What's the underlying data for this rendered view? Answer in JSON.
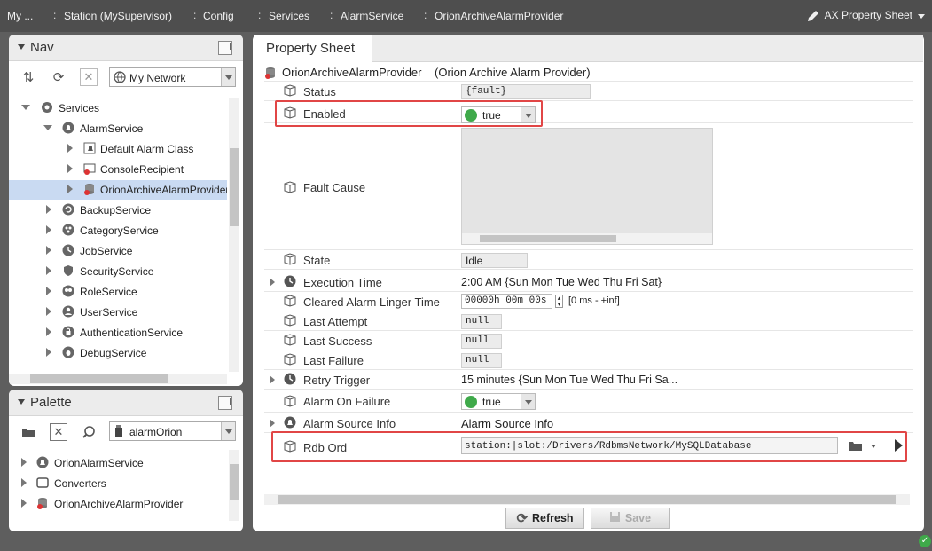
{
  "breadcrumb": [
    "My ...",
    "Station (MySupervisor)",
    "Config",
    "Services",
    "AlarmService",
    "OrionArchiveAlarmProvider"
  ],
  "view_selector": "AX Property Sheet",
  "nav": {
    "title": "Nav",
    "network_combo": "My Network",
    "tree": [
      {
        "label": "Services",
        "icon": "services-icon",
        "expanded": true
      },
      {
        "label": "AlarmService",
        "icon": "alarm-service-icon",
        "expanded": true
      },
      {
        "label": "Default Alarm Class",
        "icon": "alarm-class-icon"
      },
      {
        "label": "ConsoleRecipient",
        "icon": "console-recipient-icon"
      },
      {
        "label": "OrionArchiveAlarmProvider",
        "icon": "database-icon",
        "selected": true
      },
      {
        "label": "BackupService",
        "icon": "backup-icon"
      },
      {
        "label": "CategoryService",
        "icon": "category-icon"
      },
      {
        "label": "JobService",
        "icon": "job-icon"
      },
      {
        "label": "SecurityService",
        "icon": "shield-icon"
      },
      {
        "label": "RoleService",
        "icon": "role-icon"
      },
      {
        "label": "UserService",
        "icon": "user-icon"
      },
      {
        "label": "AuthenticationService",
        "icon": "lock-icon"
      },
      {
        "label": "DebugService",
        "icon": "debug-icon"
      }
    ]
  },
  "palette": {
    "title": "Palette",
    "module_combo": "alarmOrion",
    "items": [
      {
        "label": "OrionAlarmService",
        "icon": "alarm-service-icon"
      },
      {
        "label": "Converters",
        "icon": "folder-icon"
      },
      {
        "label": "OrionArchiveAlarmProvider",
        "icon": "database-icon"
      }
    ]
  },
  "property_sheet": {
    "tab": "Property Sheet",
    "object_name": "OrionArchiveAlarmProvider",
    "object_type": "(Orion Archive Alarm Provider)",
    "rows": {
      "status": {
        "name": "Status",
        "value": "{fault}"
      },
      "enabled": {
        "name": "Enabled",
        "value": "true"
      },
      "fault_cause": {
        "name": "Fault Cause",
        "value": ""
      },
      "state": {
        "name": "State",
        "value": "Idle"
      },
      "execution_time": {
        "name": "Execution Time",
        "value": "2:00 AM {Sun Mon Tue Wed Thu Fri Sat}"
      },
      "cleared_alarm_linger_time": {
        "name": "Cleared Alarm Linger Time",
        "value": "00000h 00m 00s",
        "range": "[0 ms - +inf]"
      },
      "last_attempt": {
        "name": "Last Attempt",
        "value": "null"
      },
      "last_success": {
        "name": "Last Success",
        "value": "null"
      },
      "last_failure": {
        "name": "Last Failure",
        "value": "null"
      },
      "retry_trigger": {
        "name": "Retry Trigger",
        "value": "15 minutes {Sun Mon Tue Wed Thu Fri Sa..."
      },
      "alarm_on_failure": {
        "name": "Alarm On Failure",
        "value": "true"
      },
      "alarm_source_info": {
        "name": "Alarm Source Info",
        "value": "Alarm Source Info"
      },
      "rdb_ord": {
        "name": "Rdb Ord",
        "value": "station:|slot:/Drivers/RdbmsNetwork/MySQLDatabase"
      }
    },
    "buttons": {
      "refresh": "Refresh",
      "save": "Save"
    }
  },
  "colors": {
    "highlight": "#e14646",
    "status_ok": "#3fa94a",
    "selection": "#c9daf2"
  }
}
